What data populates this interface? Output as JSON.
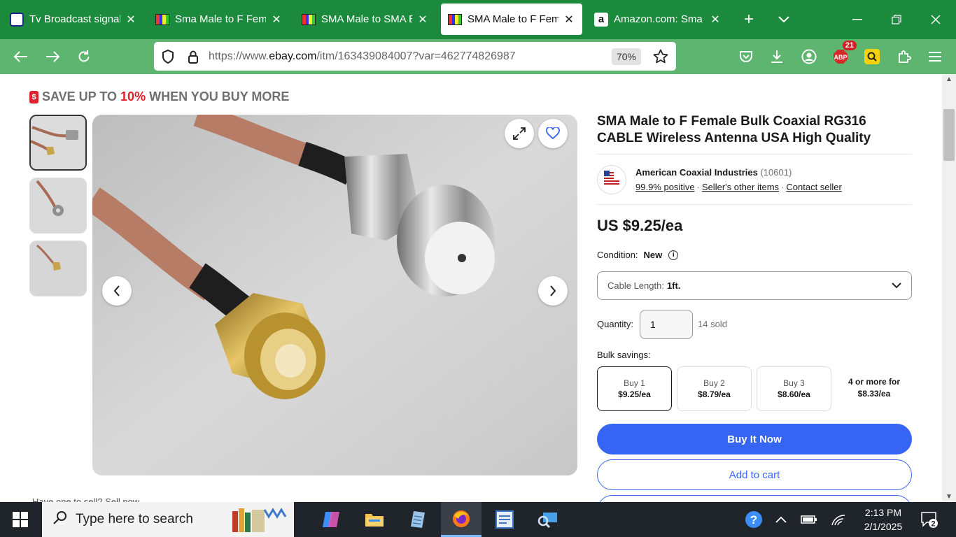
{
  "browser": {
    "tabs": [
      {
        "title": "Tv Broadcast signal`s",
        "favicon": "cap-icon",
        "active": false
      },
      {
        "title": "Sma Male to F Femal",
        "favicon": "tv-bars-icon",
        "active": false
      },
      {
        "title": "SMA Male to SMA Bu",
        "favicon": "tv-bars-icon",
        "active": false
      },
      {
        "title": "SMA Male to F Fema",
        "favicon": "tv-bars-icon",
        "active": true
      },
      {
        "title": "Amazon.com: Sma T",
        "favicon": "amazon-icon",
        "active": false
      }
    ],
    "new_tab_label": "+",
    "url_prefix": "https://www.",
    "url_domain": "ebay.com",
    "url_path": "/itm/163439084007?var=462774826987",
    "zoom": "70%",
    "abp_count": "21",
    "abp_label": "ABP"
  },
  "page": {
    "promo": {
      "prefix": "SAVE UP TO",
      "percent": "10%",
      "suffix": "WHEN YOU BUY MORE"
    },
    "bottom_text": "Have one to sell? Sell now",
    "title": "SMA Male to F Female Bulk Coaxial RG316 CABLE Wireless Antenna USA High Quality",
    "seller": {
      "name": "American Coaxial Industries",
      "feedback": "(10601)",
      "positive": "99.9% positive",
      "other_items": "Seller's other items",
      "contact": "Contact seller"
    },
    "price": "US $9.25/ea",
    "condition_label": "Condition:",
    "condition_value": "New",
    "variation_label": "Cable Length:",
    "variation_value": "1ft.",
    "quantity_label": "Quantity:",
    "quantity_value": "1",
    "sold": "14 sold",
    "bulk_label": "Bulk savings:",
    "bulk_options": [
      {
        "label": "Buy 1",
        "price": "$9.25/ea"
      },
      {
        "label": "Buy 2",
        "price": "$8.79/ea"
      },
      {
        "label": "Buy 3",
        "price": "$8.60/ea"
      }
    ],
    "bulk_more_line1": "4 or more for",
    "bulk_more_line2": "$8.33/ea",
    "buy_now": "Buy It Now",
    "add_to_cart": "Add to cart"
  },
  "taskbar": {
    "search_placeholder": "Type here to search",
    "time": "2:13 PM",
    "date": "2/1/2025",
    "notification_count": "2"
  },
  "colors": {
    "tabbar": "#1c8a3c",
    "navbar": "#5db56f",
    "accent": "#3665f3",
    "promo_red": "#e0202a"
  }
}
